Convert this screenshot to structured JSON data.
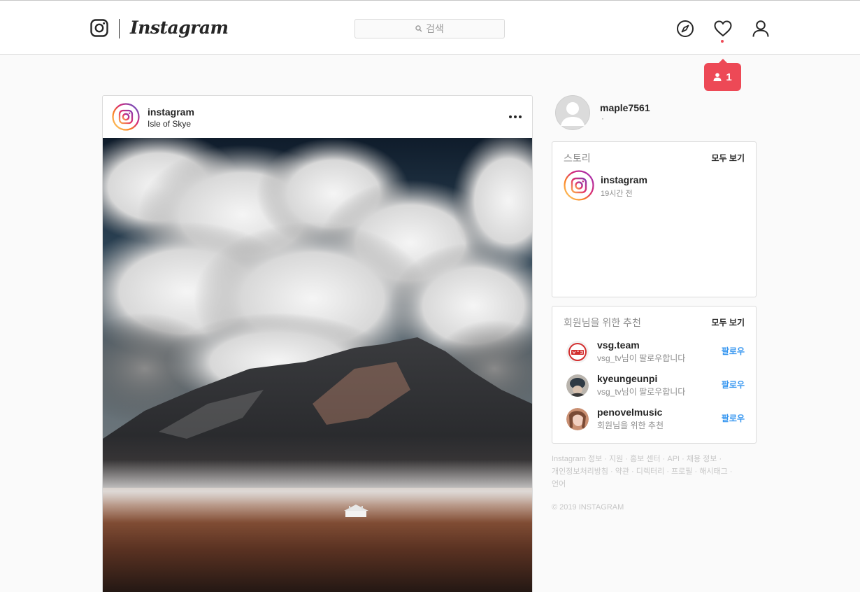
{
  "nav": {
    "brand": "Instagram",
    "search_placeholder": "검색",
    "notification_count": "1"
  },
  "post": {
    "username": "instagram",
    "location": "Isle of Skye"
  },
  "profile": {
    "username": "maple7561",
    "subtitle": "·"
  },
  "stories": {
    "title": "스토리",
    "see_all": "모두 보기",
    "items": [
      {
        "username": "instagram",
        "time": "19시간 전"
      }
    ]
  },
  "suggestions": {
    "title": "회원님을 위한 추천",
    "see_all": "모두 보기",
    "items": [
      {
        "username": "vsg.team",
        "reason": "vsg_tv님이 팔로우합니다",
        "action": "팔로우"
      },
      {
        "username": "kyeungeunpi",
        "reason": "vsg_tv님이 팔로우합니다",
        "action": "팔로우"
      },
      {
        "username": "penovelmusic",
        "reason": "회원님을 위한 추천",
        "action": "팔로우"
      }
    ]
  },
  "footer": {
    "links": [
      "Instagram 정보",
      "지원",
      "홍보 센터",
      "API",
      "채용 정보",
      "개인정보처리방침",
      "약관",
      "디렉터리",
      "프로필",
      "해시태그",
      "언어"
    ],
    "copyright": "© 2019 INSTAGRAM"
  },
  "colors": {
    "accent_blue": "#3897f0",
    "notification_red": "#ed4956",
    "border": "#dbdbdb",
    "background": "#fafafa"
  }
}
